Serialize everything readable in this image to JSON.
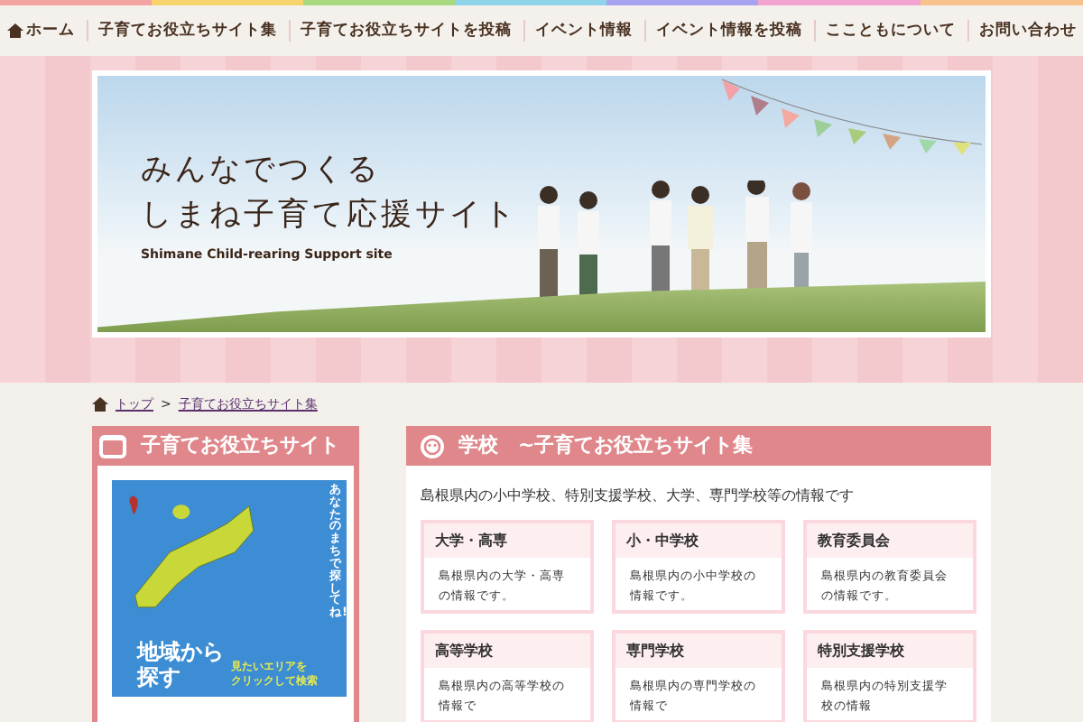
{
  "nav": {
    "items": [
      {
        "label": "ホーム",
        "kind": "home"
      },
      {
        "label": "子育てお役立ちサイト集",
        "kind": "link"
      },
      {
        "label": "子育てお役立ちサイトを投稿",
        "kind": "link"
      },
      {
        "label": "イベント情報",
        "kind": "link"
      },
      {
        "label": "イベント情報を投稿",
        "kind": "link"
      },
      {
        "label": "ここともについて",
        "kind": "link"
      },
      {
        "label": "お問い合わせ",
        "kind": "link"
      }
    ]
  },
  "hero": {
    "title_lines": [
      "みんなでつくる",
      "しまね子育て応援サイト"
    ],
    "subtitle": "Shimane Child-rearing Support site"
  },
  "breadcrumb": {
    "items": [
      "トップ",
      "子育てお役立ちサイト集"
    ],
    "separator": ">"
  },
  "sidebar": {
    "title": "子育てお役立ちサイト",
    "banner": {
      "heading_lines": [
        "地域から",
        "探す"
      ],
      "caption_lines": [
        "見たいエリアを",
        "クリックして検索"
      ],
      "vertical_text": "あなたのまちで探してね!"
    }
  },
  "main": {
    "title": "学校　~子育てお役立ちサイト集",
    "intro": "島根県内の小中学校、特別支援学校、大学、専門学校等の情報です",
    "cards": [
      {
        "title": "大学・高専",
        "description": "島根県内の大学・高専の情報です。"
      },
      {
        "title": "小・中学校",
        "description": "島根県内の小中学校の情報です。"
      },
      {
        "title": "教育委員会",
        "description": "島根県内の教育委員会の情報です。"
      },
      {
        "title": "高等学校",
        "description": "島根県内の高等学校の情報で"
      },
      {
        "title": "専門学校",
        "description": "島根県内の専門学校の情報で"
      },
      {
        "title": "特別支援学校",
        "description": "島根県内の特別支援学校の情報"
      }
    ]
  }
}
